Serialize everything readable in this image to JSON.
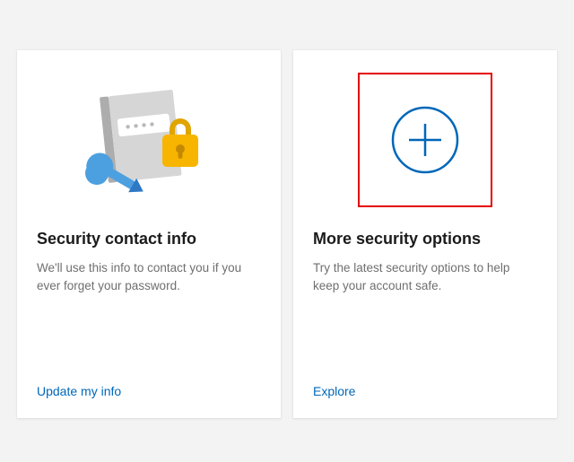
{
  "cards": [
    {
      "title": "Security contact info",
      "desc": "We'll use this info to contact you if you ever forget your password.",
      "link": "Update my info"
    },
    {
      "title": "More security options",
      "desc": "Try the latest security options to help keep your account safe.",
      "link": "Explore"
    }
  ],
  "colors": {
    "link": "#0067b8",
    "highlight": "#e60000"
  }
}
